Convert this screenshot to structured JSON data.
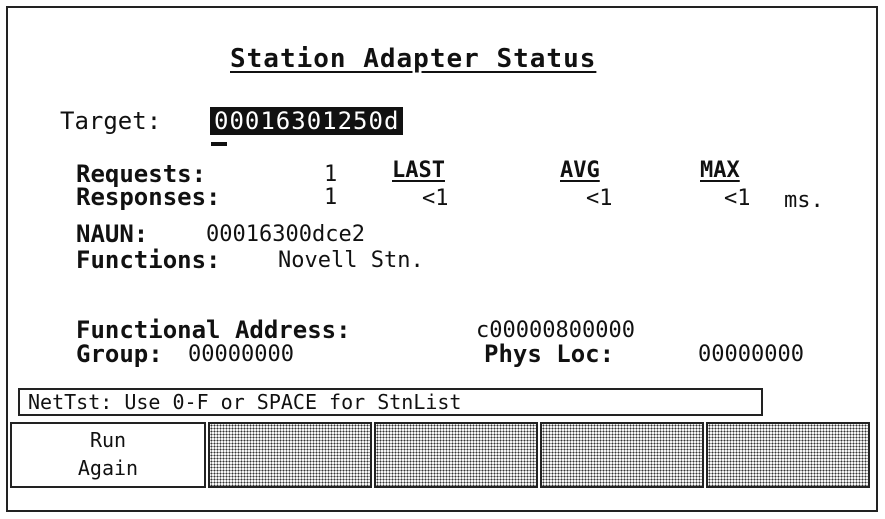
{
  "title": "Station Adapter Status",
  "target": {
    "label": "Target:",
    "value": "00016301250d"
  },
  "stats": {
    "requests_label": "Requests:",
    "requests_value": "1",
    "responses_label": "Responses:",
    "responses_value": "1",
    "headers": {
      "last": "LAST",
      "avg": "AVG",
      "max": "MAX"
    },
    "last": "<1",
    "avg": "<1",
    "max": "<1",
    "unit": "ms."
  },
  "naun": {
    "label": "NAUN:",
    "value": "00016300dce2"
  },
  "functions": {
    "label": "Functions:",
    "value": "Novell Stn."
  },
  "functional_address": {
    "label": "Functional Address:",
    "value": "c00000800000"
  },
  "group": {
    "label": "Group:",
    "value": "00000000"
  },
  "phys_loc": {
    "label": "Phys Loc:",
    "value": "00000000"
  },
  "status_line": "NetTst: Use 0-F or SPACE for StnList",
  "softkeys": [
    {
      "label": "Run\nAgain"
    },
    {
      "label": ""
    },
    {
      "label": ""
    },
    {
      "label": ""
    },
    {
      "label": ""
    }
  ]
}
